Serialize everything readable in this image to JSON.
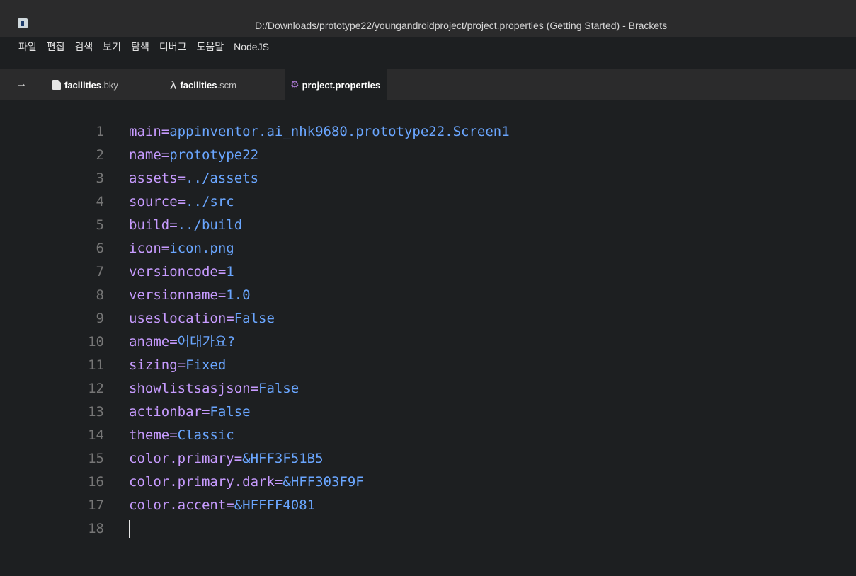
{
  "window": {
    "title": "D:/Downloads/prototype22/youngandroidproject/project.properties (Getting Started) - Brackets"
  },
  "menu": [
    "파일",
    "편집",
    "검색",
    "보기",
    "탐색",
    "디버그",
    "도움말",
    "NodeJS"
  ],
  "tabs": {
    "arrow": "→",
    "items": [
      {
        "name": "facilities",
        "ext": ".bky",
        "icon": "file-icon"
      },
      {
        "name": "facilities",
        "ext": ".scm",
        "icon": "lambda-icon",
        "icon_glyph": "λ"
      },
      {
        "name": "project.properties",
        "ext": "",
        "icon": "gear-icon",
        "icon_glyph": "⚙",
        "active": true
      }
    ]
  },
  "editor": {
    "lines": [
      {
        "num": "1",
        "key": "main",
        "value": "appinventor.ai_nhk9680.prototype22.Screen1"
      },
      {
        "num": "2",
        "key": "name",
        "value": "prototype22"
      },
      {
        "num": "3",
        "key": "assets",
        "value": "../assets"
      },
      {
        "num": "4",
        "key": "source",
        "value": "../src"
      },
      {
        "num": "5",
        "key": "build",
        "value": "../build"
      },
      {
        "num": "6",
        "key": "icon",
        "value": "icon.png"
      },
      {
        "num": "7",
        "key": "versioncode",
        "value": "1"
      },
      {
        "num": "8",
        "key": "versionname",
        "value": "1.0"
      },
      {
        "num": "9",
        "key": "useslocation",
        "value": "False"
      },
      {
        "num": "10",
        "key": "aname",
        "value": "어대가요?"
      },
      {
        "num": "11",
        "key": "sizing",
        "value": "Fixed"
      },
      {
        "num": "12",
        "key": "showlistsasjson",
        "value": "False"
      },
      {
        "num": "13",
        "key": "actionbar",
        "value": "False"
      },
      {
        "num": "14",
        "key": "theme",
        "value": "Classic"
      },
      {
        "num": "15",
        "key": "color.primary",
        "value": "&HFF3F51B5"
      },
      {
        "num": "16",
        "key": "color.primary.dark",
        "value": "&HFF303F9F"
      },
      {
        "num": "17",
        "key": "color.accent",
        "value": "&HFFFF4081"
      },
      {
        "num": "18",
        "key": "",
        "value": ""
      }
    ],
    "equals": "="
  },
  "colors": {
    "background": "#1d1f21",
    "chrome": "#2b2b2c",
    "key": "#c79bff",
    "value": "#6aa6ff",
    "line_number": "#767676",
    "gear": "#b07cd8"
  }
}
